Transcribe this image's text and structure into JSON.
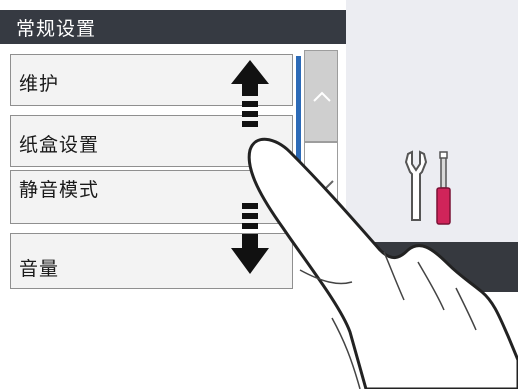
{
  "title": "常规设置",
  "menu_items": [
    {
      "label": "维护"
    },
    {
      "label": "纸盒设置"
    },
    {
      "label": "静音模式"
    },
    {
      "label": "音量"
    }
  ],
  "scroll": {
    "up_icon": "chevron-up-icon",
    "down_icon": "chevron-down-icon"
  },
  "icons": {
    "tools": "wrench-screwdriver-icon",
    "gesture": "swipe-up-down-icon",
    "hand": "hand-pointer-icon"
  },
  "colors": {
    "title_bar": "#363a42",
    "scroll_indicator": "#2c6ab7",
    "screwdriver": "#d0245a",
    "background_panel": "#ecedf2"
  }
}
